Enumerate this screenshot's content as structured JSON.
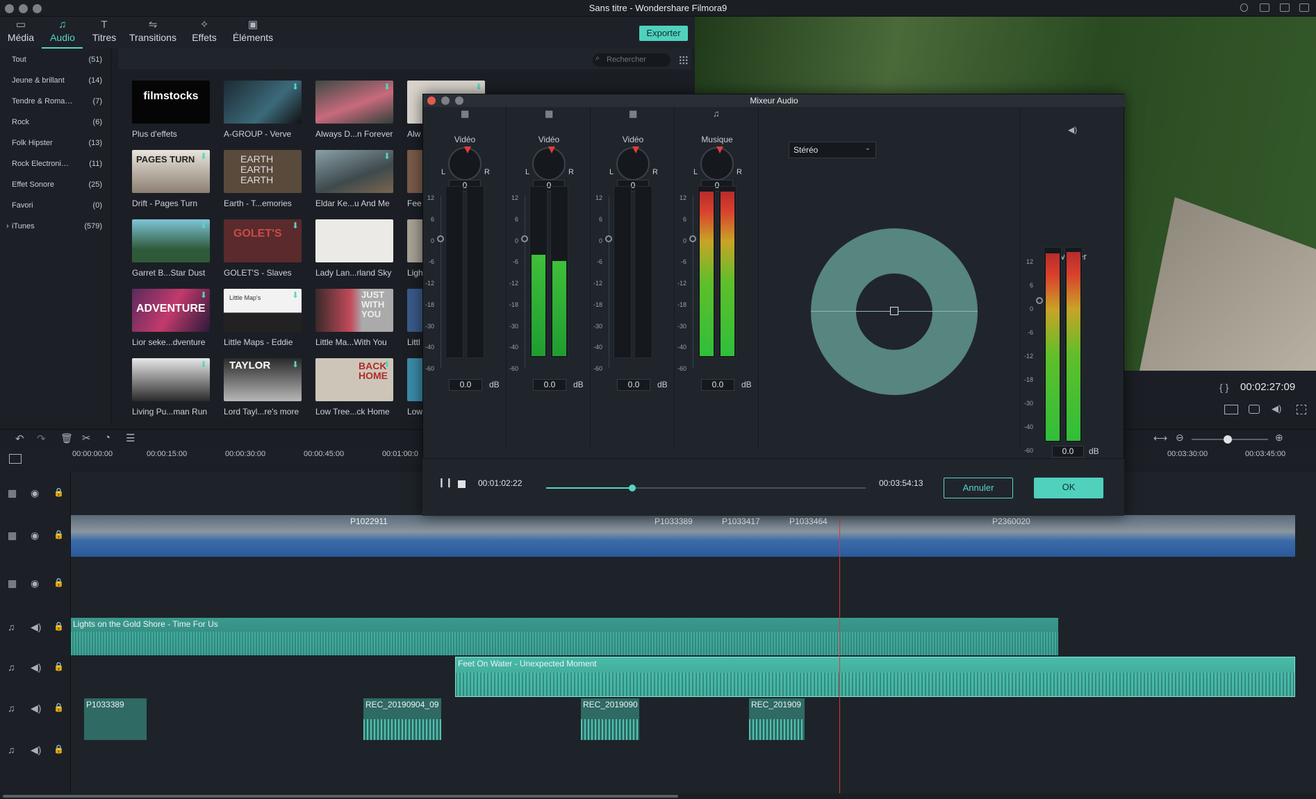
{
  "window": {
    "title": "Sans titre - Wondershare Filmora9"
  },
  "tabs": [
    {
      "label": "Média",
      "icon": "folder-icon"
    },
    {
      "label": "Audio",
      "icon": "music-note-icon"
    },
    {
      "label": "Titres",
      "icon": "text-icon"
    },
    {
      "label": "Transitions",
      "icon": "transition-icon"
    },
    {
      "label": "Effets",
      "icon": "effects-icon"
    },
    {
      "label": "Éléments",
      "icon": "image-icon"
    }
  ],
  "export_label": "Exporter",
  "search_placeholder": "Rechercher",
  "categories": [
    {
      "name": "Tout",
      "count": "(51)"
    },
    {
      "name": "Jeune & brillant",
      "count": "(14)"
    },
    {
      "name": "Tendre & Roma…",
      "count": "(7)"
    },
    {
      "name": "Rock",
      "count": "(6)"
    },
    {
      "name": "Folk Hipster",
      "count": "(13)"
    },
    {
      "name": "Rock Electroni…",
      "count": "(11)"
    },
    {
      "name": "Effet Sonore",
      "count": "(25)"
    },
    {
      "name": "Favori",
      "count": "(0)"
    },
    {
      "name": "iTunes",
      "count": "(579)"
    }
  ],
  "audio_items": [
    [
      "Plus d'effets",
      "A-GROUP - Verve",
      "Always D...n Forever",
      "Alw"
    ],
    [
      "Drift - Pages Turn",
      "Earth - T...emories",
      "Eldar Ke...u And Me",
      "Fee"
    ],
    [
      "Garret B...Star Dust",
      "GOLET'S - Slaves",
      "Lady Lan...rland Sky",
      "Ligh"
    ],
    [
      "Lior seke...dventure",
      "Little Maps - Eddie",
      "Little Ma...With You",
      "Littl"
    ],
    [
      "Living Pu...man Run",
      "Lord Tayl...re's more",
      "Low Tree...ck Home",
      "Low"
    ]
  ],
  "thumb_texts": {
    "filmstocks": "filmstocks",
    "pagesturn": "PAGES TURN",
    "earth": "EARTH EARTH EARTH",
    "golets": "GOLET'S",
    "adventure": "ADVENTURE",
    "littlemaps": "Little Map's",
    "justwith": "JUST WITH YOU",
    "taylor": "TAYLOR",
    "backhome": "BACK HOME"
  },
  "preview": {
    "timecode": "00:02:27:09"
  },
  "ruler_ticks": [
    "00:00:00:00",
    "00:00:15:00",
    "00:00:30:00",
    "00:00:45:00",
    "00:01:00:0",
    "00:03:30:00",
    "00:03:45:00"
  ],
  "clips": {
    "video_labels": [
      "P1022911",
      "P1033389",
      "P1033417",
      "P1033464",
      "P2360020"
    ],
    "audio1": "Lights on the Gold Shore - Time For Us",
    "audio2": "Feet On Water - Unexpected Moment",
    "small": [
      "P1033389",
      "REC_20190904_09",
      "REC_2019090",
      "REC_201909"
    ]
  },
  "mixer": {
    "title": "Mixeur Audio",
    "channels": [
      {
        "name": "Vidéo",
        "pan": "0",
        "db": "0.0",
        "level_l": 0,
        "level_r": 0
      },
      {
        "name": "Vidéo",
        "pan": "0",
        "db": "0.0",
        "level_l": 0.6,
        "level_r": 0.56
      },
      {
        "name": "Vidéo",
        "pan": "0",
        "db": "0.0",
        "level_l": 0,
        "level_r": 0
      },
      {
        "name": "Musique",
        "pan": "0",
        "db": "0.0",
        "level_l": 0.97,
        "level_r": 0.97
      }
    ],
    "lr": [
      "L",
      "R"
    ],
    "db_unit": "dB",
    "scale": [
      "12",
      "6",
      "0",
      "-6",
      "-12",
      "-18",
      "-30",
      "-40",
      "-60"
    ],
    "mode": "Stéréo",
    "master": {
      "name": "Master",
      "db": "0.0",
      "level_l": 0.97,
      "level_r": 0.98
    },
    "current_time": "00:01:02:22",
    "total_time": "00:03:54:13",
    "progress": 0.27,
    "cancel_label": "Annuler",
    "ok_label": "OK"
  },
  "colors": {
    "accent": "#56d6c3",
    "playhead": "#d63a3a"
  }
}
